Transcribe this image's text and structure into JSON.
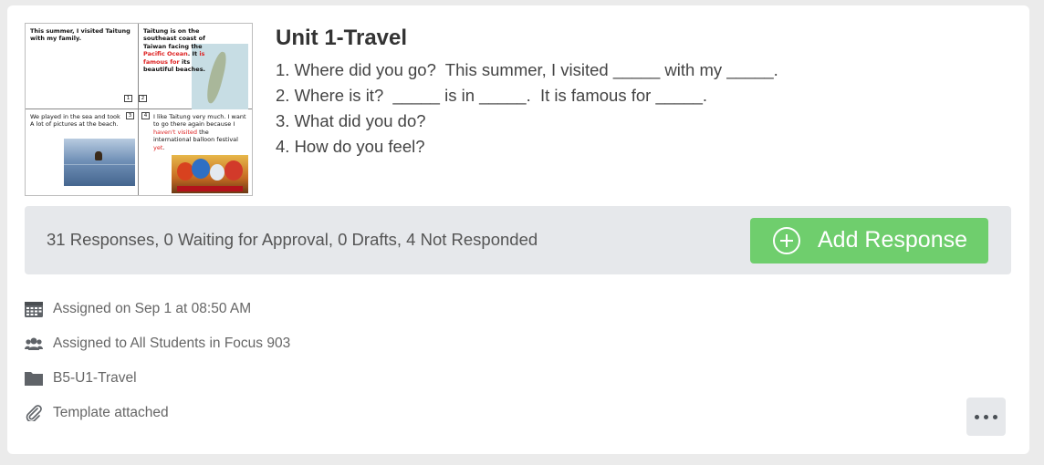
{
  "assignment": {
    "title": "Unit 1-Travel",
    "questions": [
      "1. Where did you go?  This summer, I visited _____ with my _____.",
      "2. Where is it?  _____ is in _____.  It is famous for _____.",
      "3. What did you do?",
      "4. How do you feel?"
    ]
  },
  "thumbnail": {
    "q1_text": "This summer, I visited Taitung with my family.",
    "q2_text_a": "Taitung is on the southeast coast of Taiwan facing the ",
    "q2_text_highlight1": "Pacific Ocean",
    "q2_text_b": ". It ",
    "q2_text_highlight2": "is famous for",
    "q2_text_c": " its beautiful beaches.",
    "q3_text": "We played in the sea and took A lot of pictures at the beach.",
    "q4_text_a": "I like Taitung very much. I want to go there again because I ",
    "q4_text_highlight1": "haven't visited",
    "q4_text_b": " the international balloon festival ",
    "q4_text_highlight2": "yet",
    "q4_text_c": ".",
    "num_1": "1",
    "num_2": "2",
    "num_3": "3",
    "num_4": "4"
  },
  "status": {
    "summary": "31 Responses, 0 Waiting for Approval, 0 Drafts, 4 Not Responded",
    "add_response_label": "Add Response",
    "add_button_color": "#6fce6d"
  },
  "meta": {
    "assigned_on": "Assigned on Sep 1 at 08:50 AM",
    "assigned_to": "Assigned to All Students in Focus 903",
    "folder": "B5-U1-Travel",
    "template": "Template attached"
  },
  "icons": [
    "calendar-icon",
    "users-icon",
    "folder-icon",
    "paperclip-icon",
    "plus-circle-icon",
    "more-dots-icon"
  ]
}
